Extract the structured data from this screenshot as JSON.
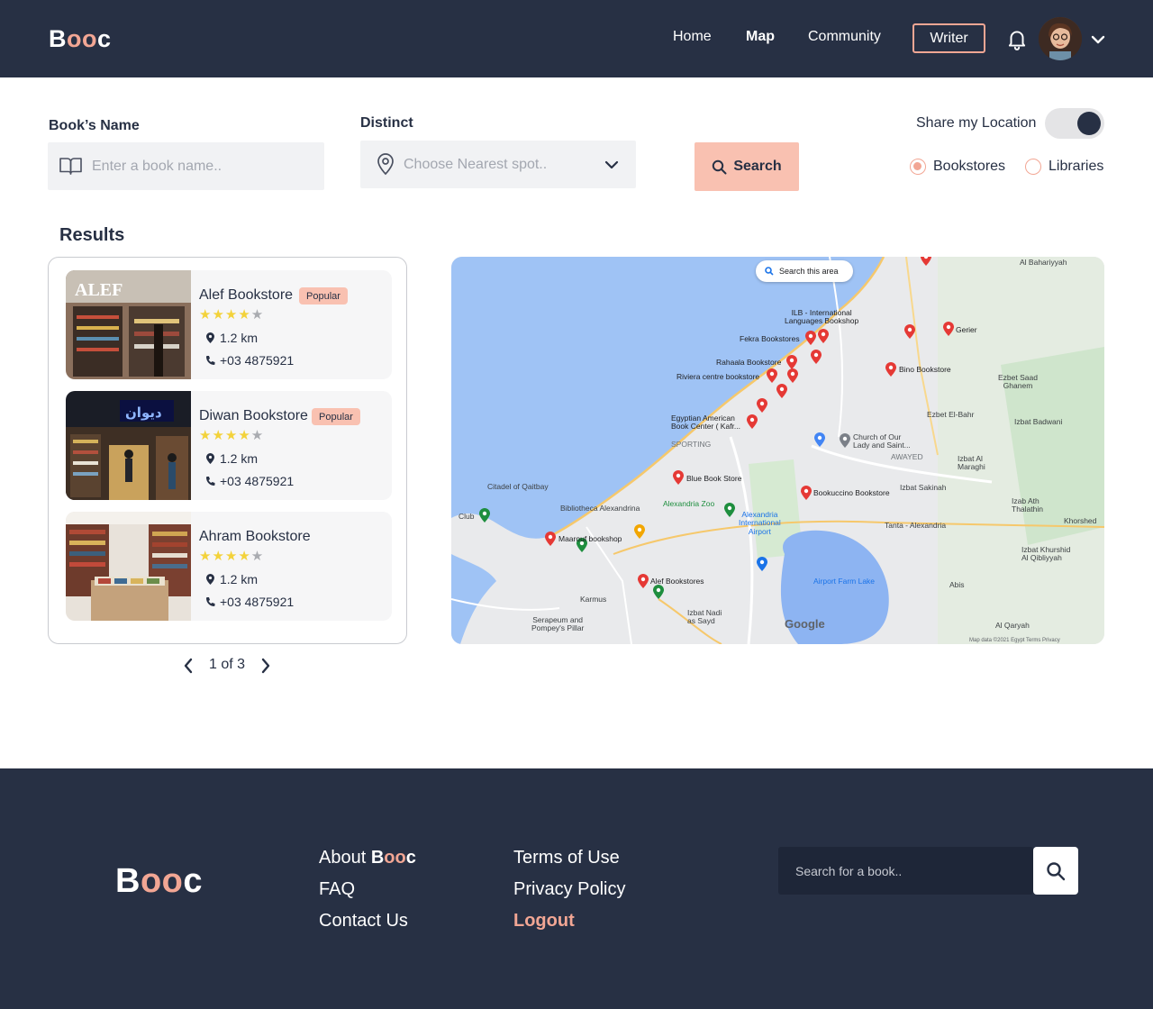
{
  "header": {
    "logo": {
      "first": "B",
      "middle": "oo",
      "last": "c"
    },
    "nav": {
      "home": "Home",
      "map": "Map",
      "community": "Community"
    },
    "writer": "Writer"
  },
  "search": {
    "book_label": "Book’s Name",
    "book_placeholder": "Enter a book name..",
    "district_label": "Distinct",
    "district_placeholder": "Choose Nearest spot..",
    "search_button": "Search",
    "share_location_label": "Share my Location",
    "share_location_on": true,
    "options": [
      {
        "label": "Bookstores",
        "selected": true
      },
      {
        "label": "Libraries",
        "selected": false
      }
    ]
  },
  "results": {
    "title": "Results",
    "items": [
      {
        "name": "Alef Bookstore",
        "badge": "Popular",
        "rating": 4,
        "max_rating": 5,
        "distance": "1.2 km",
        "phone": "+03 4875921"
      },
      {
        "name": "Diwan Bookstore",
        "badge": "Popular",
        "rating": 4,
        "max_rating": 5,
        "distance": "1.2 km",
        "phone": "+03 4875921"
      },
      {
        "name": "Ahram Bookstore",
        "badge": "",
        "rating": 4,
        "max_rating": 5,
        "distance": "1.2 km",
        "phone": "+03 4875921"
      }
    ],
    "pagination": "1 of 3"
  },
  "map": {
    "search_this_area": "Search this area",
    "labels": {
      "ilb": "ILB - International\nLanguages Bookshop",
      "fekra": "Fekra Bookstores",
      "rahaala": "Rahaala Bookstore",
      "riviera": "Riviera centre bookstore",
      "egyptian": "Egyptian American\nBook Center ( Kafr...",
      "gerier": "Gerier",
      "bino": "Bino Bookstore",
      "blue": "Blue Book Store",
      "church": "Church of Our\nLady and Saint...",
      "bookuccino": "Bookuccino Bookstore",
      "citadel": "Citadel of Qaitbay",
      "bibliotheca": "Bibliotheca Alexandrina",
      "zoo": "Alexandria Zoo",
      "airport": "Alexandria\nInternational\nAirport",
      "maarouf": "Maarouf bookshop",
      "alef": "Alef Bookstores",
      "karmus": "Karmus",
      "serapeum": "Serapeum and\nPompey's Pillar",
      "lake": "Airport Farm Lake",
      "sporting": "SPORTING",
      "awayed": "AWAYED",
      "club": "Club",
      "bahariyyah": "Al Bahariyyah",
      "ezbet_saad": "Ezbet Saad\nGhanem",
      "ezbet_bahr": "Ezbet El-Bahr",
      "badwani": "Izbat Badwani",
      "maraghi": "Izbat Al\nMaraghi",
      "sakinah": "Izbat Sakinah",
      "izab_ath": "Izab Ath\nThalathin",
      "khorshed": "Khorshed",
      "khurshid": "Izbat Khurshid\nAl Qibliyyah",
      "tanta": "Tanta - Alexandria",
      "nadi": "Izbat Nadi\nas Sayd",
      "abis": "Abis",
      "qaryah": "Al Qaryah",
      "google": "Google",
      "footer": "Map data ©2021   Egypt   Terms   Privacy"
    }
  },
  "footer": {
    "links_col1": {
      "about_prefix": "About",
      "faq": "FAQ",
      "contact": "Contact Us"
    },
    "links_col2": {
      "terms": "Terms of Use",
      "privacy": "Privacy Policy",
      "logout": "Logout"
    },
    "search_placeholder": "Search for a book.."
  },
  "colors": {
    "navy": "#273044",
    "accent": "#f2a694",
    "accent_light": "#f9c1b1",
    "star": "#f3d23a",
    "pin": "#e53935"
  }
}
